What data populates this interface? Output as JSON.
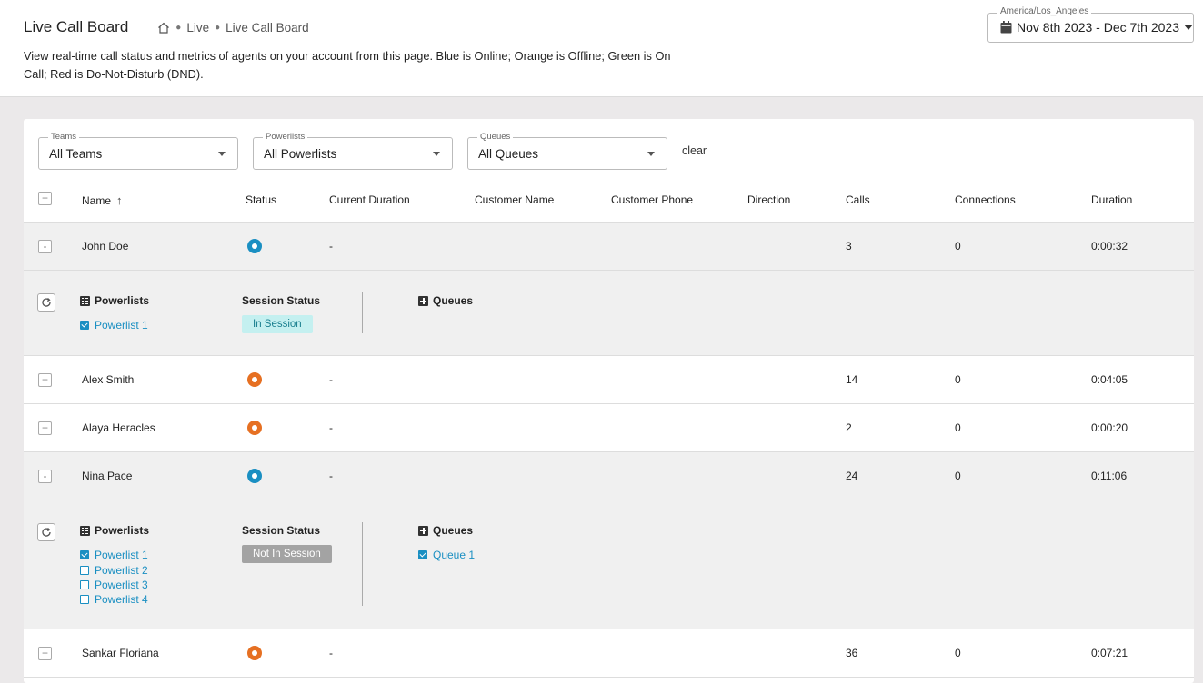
{
  "header": {
    "title": "Live Call Board",
    "breadcrumb": [
      "Live",
      "Live Call Board"
    ],
    "description": "View real-time call status and metrics of agents on your account from this page. Blue is Online; Orange is Offline; Green is On Call; Red is Do-Not-Disturb (DND).",
    "timezone": "America/Los_Angeles",
    "date_range": "Nov 8th 2023 - Dec 7th 2023"
  },
  "filters": {
    "teams": {
      "label": "Teams",
      "value": "All Teams"
    },
    "powerlists": {
      "label": "Powerlists",
      "value": "All Powerlists"
    },
    "queues": {
      "label": "Queues",
      "value": "All Queues"
    },
    "clear": "clear"
  },
  "table": {
    "columns": {
      "name": "Name",
      "status": "Status",
      "current_duration": "Current Duration",
      "customer_name": "Customer Name",
      "customer_phone": "Customer Phone",
      "direction": "Direction",
      "calls": "Calls",
      "connections": "Connections",
      "duration": "Duration"
    },
    "rows": [
      {
        "name": "John Doe",
        "status": "online",
        "current_duration": "-",
        "calls": "3",
        "connections": "0",
        "duration": "0:00:32",
        "expanded": true
      },
      {
        "name": "Alex Smith",
        "status": "offline",
        "current_duration": "-",
        "calls": "14",
        "connections": "0",
        "duration": "0:04:05",
        "expanded": false
      },
      {
        "name": "Alaya Heracles",
        "status": "offline",
        "current_duration": "-",
        "calls": "2",
        "connections": "0",
        "duration": "0:00:20",
        "expanded": false
      },
      {
        "name": "Nina Pace",
        "status": "online",
        "current_duration": "-",
        "calls": "24",
        "connections": "0",
        "duration": "0:11:06",
        "expanded": true
      },
      {
        "name": "Sankar Floriana",
        "status": "offline",
        "current_duration": "-",
        "calls": "36",
        "connections": "0",
        "duration": "0:07:21",
        "expanded": false
      }
    ],
    "details": [
      {
        "powerlists_title": "Powerlists",
        "session_status_title": "Session Status",
        "queues_title": "Queues",
        "powerlists": [
          {
            "label": "Powerlist 1",
            "checked": true
          }
        ],
        "session_status": "In Session",
        "queues": []
      },
      {
        "powerlists_title": "Powerlists",
        "session_status_title": "Session Status",
        "queues_title": "Queues",
        "powerlists": [
          {
            "label": "Powerlist 1",
            "checked": true
          },
          {
            "label": "Powerlist 2",
            "checked": false
          },
          {
            "label": "Powerlist 3",
            "checked": false
          },
          {
            "label": "Powerlist 4",
            "checked": false
          }
        ],
        "session_status": "Not In Session",
        "queues": [
          {
            "label": "Queue 1",
            "checked": true
          }
        ]
      }
    ]
  },
  "colors": {
    "online": "#1a8fc2",
    "offline": "#e67022",
    "link": "#1a8fc2"
  }
}
